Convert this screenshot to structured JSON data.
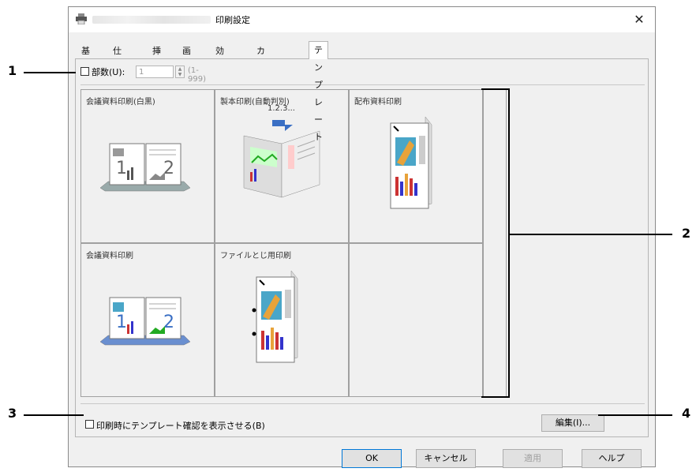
{
  "window": {
    "title": "印刷設定",
    "close_label": "✕"
  },
  "tabs": [
    {
      "label": "基本"
    },
    {
      "label": "仕上げ"
    },
    {
      "label": "挿入"
    },
    {
      "label": "画質"
    },
    {
      "label": "効果"
    },
    {
      "label": "カスタム"
    },
    {
      "label": "テンプレート",
      "active": true
    }
  ],
  "copies": {
    "label": "部数(U):",
    "value": "1",
    "range": "(1-999)",
    "checked": false
  },
  "templates": [
    {
      "label": "会議資料印刷(白黒)"
    },
    {
      "label": "製本印刷(自動判別)",
      "sublabel": "1.2.3..."
    },
    {
      "label": "配布資料印刷"
    },
    {
      "label": "会議資料印刷"
    },
    {
      "label": "ファイルとじ用印刷"
    },
    {
      "label": ""
    }
  ],
  "confirm": {
    "label": "印刷時にテンプレート確認を表示させる(B)",
    "checked": false
  },
  "edit_button": "編集(I)...",
  "buttons": {
    "ok": "OK",
    "cancel": "キャンセル",
    "apply": "適用",
    "help": "ヘルプ"
  },
  "callouts": [
    "1",
    "2",
    "3",
    "4"
  ],
  "colors": {
    "dialog_bg": "#f0f0f0",
    "accent": "#0078d7",
    "arrow_blue": "#3a6fc4"
  }
}
